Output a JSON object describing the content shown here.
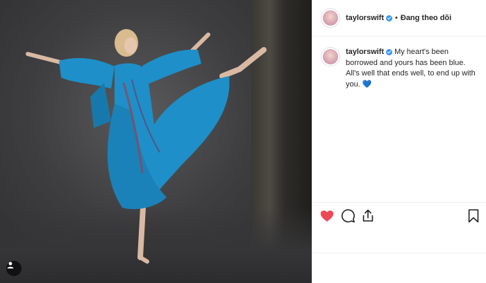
{
  "post": {
    "username": "taylorswift",
    "follow_label": "Đang theo dõi",
    "separator": "•",
    "caption": "My heart's been borrowed and yours has been blue. All's well that ends well, to end up with you.",
    "caption_emoji": "💙"
  },
  "colors": {
    "liked_heart": "#ed4956",
    "verified": "#3897f0",
    "dress": "#1e8fc8"
  },
  "icons": {
    "like": "heart-filled-icon",
    "comment": "comment-icon",
    "share": "share-icon",
    "save": "bookmark-icon",
    "user": "user-tag-icon"
  }
}
